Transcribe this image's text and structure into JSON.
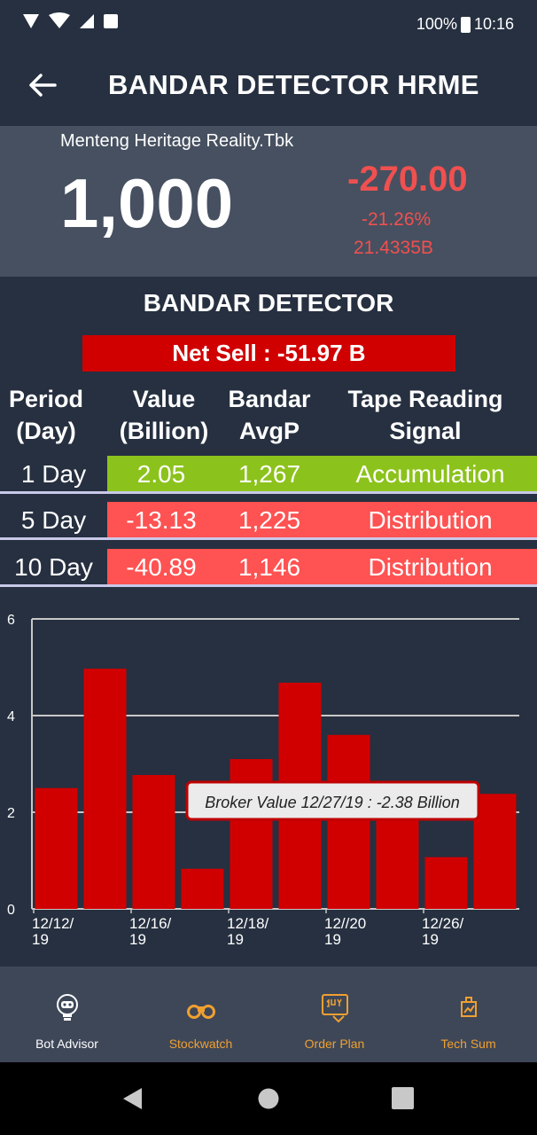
{
  "status": {
    "battery": "100%",
    "time": "10:16"
  },
  "header": {
    "back_icon": "arrow-left-icon",
    "title": "BANDAR DETECTOR HRME"
  },
  "quote": {
    "company": "Menteng Heritage Reality.Tbk",
    "price": "1,000",
    "change": "-270.00",
    "change_pct": "-21.26%",
    "volume": "21.4335B",
    "negative_color": "#f05050"
  },
  "detector": {
    "title": "BANDAR DETECTOR",
    "net_sell": "Net Sell : -51.97 B",
    "headers": [
      "Period\n(Day)",
      "Value\n(Billion)",
      "Bandar\nAvgP",
      "Tape Reading\nSignal"
    ],
    "rows": [
      {
        "period": "1 Day",
        "value": "2.05",
        "avgp": "1,267",
        "signal": "Accumulation",
        "color": "#8cc21c"
      },
      {
        "period": "5 Day",
        "value": "-13.13",
        "avgp": "1,225",
        "signal": "Distribution",
        "color": "#ff5252"
      },
      {
        "period": "10 Day",
        "value": "-40.89",
        "avgp": "1,146",
        "signal": "Distribution",
        "color": "#ff5252"
      }
    ]
  },
  "chart_data": {
    "type": "bar",
    "values": [
      2.5,
      4.97,
      2.77,
      0.83,
      3.1,
      4.68,
      3.6,
      2.38,
      1.07,
      2.38
    ],
    "tick_labels": [
      "12/12/\n19",
      "12/16/\n19",
      "12/18/\n19",
      "12//20\n19",
      "12/26/\n19"
    ],
    "ylim": [
      0,
      6
    ],
    "yticks": [
      "0",
      "2",
      "4",
      "6"
    ],
    "bar_color": "#d10000",
    "grid": true,
    "tooltip": "Broker Value 12/27/19 : -2.38 Billion"
  },
  "nav": [
    {
      "label": "Bot Advisor",
      "icon": "bot-advisor-icon",
      "color": "#ffffff"
    },
    {
      "label": "Stockwatch",
      "icon": "binoculars-icon",
      "color": "#f0a030"
    },
    {
      "label": "Order Plan",
      "icon": "buy-cart-icon",
      "color": "#f0a030"
    },
    {
      "label": "Tech Sum",
      "icon": "tech-sum-icon",
      "color": "#f0a030"
    }
  ]
}
